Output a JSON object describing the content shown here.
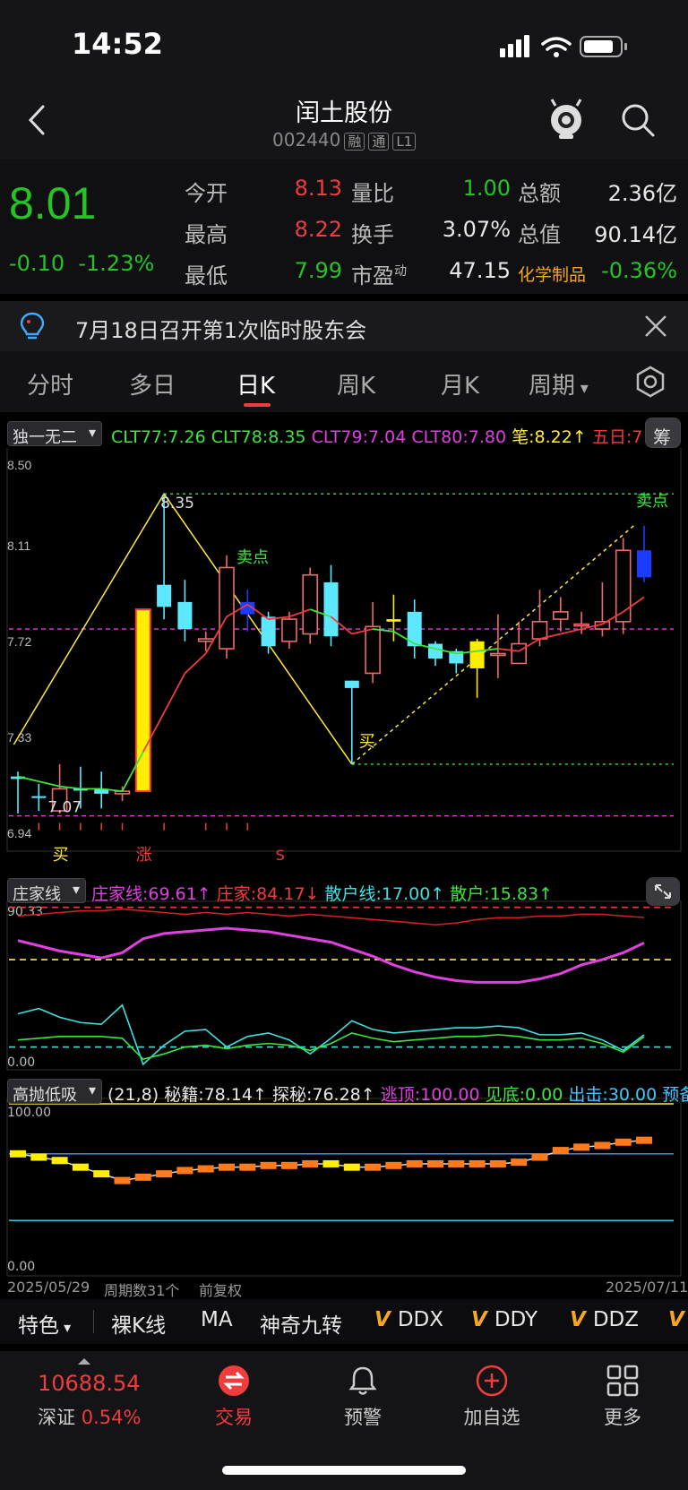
{
  "status": {
    "time": "14:52"
  },
  "header": {
    "title": "闰土股份",
    "code": "002440",
    "tags": [
      "融",
      "通",
      "L1"
    ]
  },
  "quote": {
    "price": "8.01",
    "change": "-0.10",
    "change_pct": "-1.23%",
    "rows": [
      {
        "l1": "今开",
        "v1": "8.13",
        "l2": "量比",
        "v2": "1.00",
        "l3": "总额",
        "v3": "2.36亿"
      },
      {
        "l1": "最高",
        "v1": "8.22",
        "l2": "换手",
        "v2": "3.07%",
        "l3": "总值",
        "v3": "90.14亿"
      },
      {
        "l1": "最低",
        "v1": "7.99",
        "l2": "市盈",
        "l2_sup": "动",
        "v2": "47.15",
        "l3": "化学制品",
        "v3": "-0.36%"
      }
    ],
    "colors": {
      "up": "#f03c3c",
      "down": "#26c326"
    }
  },
  "notice": {
    "text": "7月18日召开第1次临时股东会"
  },
  "tabs": [
    "分时",
    "多日",
    "日K",
    "周K",
    "月K",
    "周期",
    "设置"
  ],
  "active_tab": "日K",
  "main_chart": {
    "indicator_name": "独一无二",
    "legend": [
      {
        "text": "CLT77:7.26",
        "color": "#3ce63c"
      },
      {
        "text": "CLT78:8.35",
        "color": "#3ce63c"
      },
      {
        "text": "CLT79:7.04",
        "color": "#e040e0"
      },
      {
        "text": "CLT80:7.80",
        "color": "#e040e0"
      },
      {
        "text": "笔:8.22↑",
        "color": "#ffeb3b"
      },
      {
        "text": "五日:7",
        "color": "#f03c3c"
      }
    ],
    "chip_button": "筹",
    "y_labels": [
      "8.50",
      "8.11",
      "7.72",
      "7.33",
      "6.94"
    ],
    "annotations": {
      "high": "8.35",
      "low": "7.07",
      "sell1": "卖点",
      "sell2": "卖点",
      "buy1": "买",
      "buy2": "买",
      "zhang": "涨",
      "s": "S"
    }
  },
  "chart_data": {
    "type": "candlestick",
    "ylim": [
      6.94,
      8.5
    ],
    "x_start": "2025/05/29",
    "x_end": "2025/07/11",
    "period_count": "周期数31个",
    "adjust": "前复权",
    "candles": [
      {
        "o": 7.2,
        "c": 7.19,
        "h": 7.22,
        "l": 7.05
      },
      {
        "o": 7.12,
        "c": 7.12,
        "h": 7.17,
        "l": 7.06
      },
      {
        "o": 7.06,
        "c": 7.15,
        "h": 7.25,
        "l": 7.05
      },
      {
        "o": 7.15,
        "c": 7.15,
        "h": 7.24,
        "l": 7.07
      },
      {
        "o": 7.13,
        "c": 7.15,
        "h": 7.22,
        "l": 7.07
      },
      {
        "o": 7.13,
        "c": 7.14,
        "h": 7.16,
        "l": 7.1
      },
      {
        "o": 7.14,
        "c": 7.88,
        "h": 7.88,
        "l": 7.14
      },
      {
        "o": 7.98,
        "c": 7.89,
        "h": 8.35,
        "l": 7.84
      },
      {
        "o": 7.91,
        "c": 7.8,
        "h": 8.0,
        "l": 7.75
      },
      {
        "o": 7.75,
        "c": 7.76,
        "h": 7.79,
        "l": 7.71
      },
      {
        "o": 7.72,
        "c": 8.05,
        "h": 8.1,
        "l": 7.68
      },
      {
        "o": 7.91,
        "c": 7.86,
        "h": 7.96,
        "l": 7.79
      },
      {
        "o": 7.85,
        "c": 7.73,
        "h": 7.87,
        "l": 7.7
      },
      {
        "o": 7.75,
        "c": 7.84,
        "h": 7.87,
        "l": 7.72
      },
      {
        "o": 7.78,
        "c": 8.02,
        "h": 8.05,
        "l": 7.74
      },
      {
        "o": 7.99,
        "c": 7.77,
        "h": 8.06,
        "l": 7.73
      },
      {
        "o": 7.59,
        "c": 7.56,
        "h": 7.59,
        "l": 7.25
      },
      {
        "o": 7.62,
        "c": 7.81,
        "h": 7.91,
        "l": 7.58
      },
      {
        "o": 7.84,
        "c": 7.83,
        "h": 7.94,
        "l": 7.75
      },
      {
        "o": 7.87,
        "c": 7.73,
        "h": 7.92,
        "l": 7.68
      },
      {
        "o": 7.74,
        "c": 7.68,
        "h": 7.75,
        "l": 7.65
      },
      {
        "o": 7.71,
        "c": 7.66,
        "h": 7.72,
        "l": 7.62
      },
      {
        "o": 7.64,
        "c": 7.75,
        "h": 7.76,
        "l": 7.52
      },
      {
        "o": 7.7,
        "c": 7.7,
        "h": 7.86,
        "l": 7.6
      },
      {
        "o": 7.66,
        "c": 7.74,
        "h": 7.83,
        "l": 7.66
      },
      {
        "o": 7.76,
        "c": 7.83,
        "h": 7.96,
        "l": 7.73
      },
      {
        "o": 7.84,
        "c": 7.87,
        "h": 7.93,
        "l": 7.79
      },
      {
        "o": 7.82,
        "c": 7.82,
        "h": 7.87,
        "l": 7.78
      },
      {
        "o": 7.8,
        "c": 7.83,
        "h": 7.99,
        "l": 7.77
      },
      {
        "o": 7.83,
        "c": 8.12,
        "h": 8.17,
        "l": 7.78
      },
      {
        "o": 8.12,
        "c": 8.01,
        "h": 8.22,
        "l": 7.99
      }
    ],
    "ma5": [
      7.2,
      7.18,
      7.16,
      7.15,
      7.15,
      7.14,
      7.3,
      7.46,
      7.62,
      7.7,
      7.85,
      7.9,
      7.84,
      7.85,
      7.88,
      7.85,
      7.78,
      7.8,
      7.79,
      7.74,
      7.72,
      7.7,
      7.71,
      7.72,
      7.71,
      7.76,
      7.78,
      7.8,
      7.82,
      7.87,
      7.93
    ]
  },
  "sub1": {
    "name": "庄家线",
    "legend": [
      {
        "text": "庄家线:69.61↑",
        "color": "#e040e0"
      },
      {
        "text": "庄家:84.17↓",
        "color": "#f03c3c"
      },
      {
        "text": "散户线:17.00↑",
        "color": "#40e0e0"
      },
      {
        "text": "散户:15.83↑",
        "color": "#3ce63c"
      }
    ],
    "y_top": "90.33",
    "y_bottom": "0.00",
    "series": {
      "zhuangjia_line": [
        71,
        68,
        65,
        63,
        61,
        64,
        72,
        75,
        76,
        77,
        78,
        77,
        76,
        74,
        72,
        70,
        66,
        62,
        57,
        53,
        50,
        48,
        47,
        47,
        47,
        49,
        52,
        57,
        60,
        64,
        69.61
      ],
      "zhuangjia": [
        85,
        86,
        87,
        88,
        88,
        89,
        88,
        87,
        86,
        87,
        86,
        87,
        86,
        85,
        86,
        85,
        84,
        83,
        82,
        81,
        80,
        81,
        83,
        84,
        84,
        85,
        85,
        86,
        86,
        85,
        84.17
      ],
      "sanhu_line": [
        29,
        32,
        27,
        24,
        23,
        34,
        0,
        11,
        19,
        20,
        10,
        16,
        18,
        14,
        6,
        15,
        25,
        20,
        18,
        19,
        20,
        21,
        21,
        22,
        21,
        17,
        17,
        18,
        14,
        8,
        17
      ],
      "sanhu": [
        14,
        15,
        16,
        16,
        16,
        15,
        3,
        6,
        10,
        11,
        9,
        11,
        12,
        11,
        8,
        12,
        18,
        15,
        13,
        14,
        15,
        16,
        16,
        17,
        16,
        14,
        14,
        15,
        12,
        7,
        15.83
      ]
    }
  },
  "sub2": {
    "name": "高抛低吸",
    "legend": [
      {
        "text": "(21,8)",
        "color": "#e8e8e8"
      },
      {
        "text": "秘籍:78.14↑",
        "color": "#e8e8e8"
      },
      {
        "text": "探秘:76.28↑",
        "color": "#e8e8e8"
      },
      {
        "text": "逃顶:100.00",
        "color": "#e040e0"
      },
      {
        "text": "见底:0.00",
        "color": "#3ce63c"
      },
      {
        "text": "出击:30.00",
        "color": "#40c8ff"
      },
      {
        "text": "预备:",
        "color": "#40c8ff"
      }
    ],
    "y_top": "100.00",
    "y_bottom": "0.00",
    "series": {
      "miji": [
        70,
        68,
        66,
        62,
        58,
        54,
        56,
        58,
        60,
        61,
        62,
        62,
        63,
        63,
        64,
        64,
        62,
        62,
        63,
        64,
        64,
        64,
        64,
        64,
        65,
        68,
        72,
        74,
        75,
        77,
        78.14
      ],
      "up_flags": [
        false,
        false,
        false,
        false,
        false,
        true,
        true,
        true,
        true,
        true,
        true,
        true,
        true,
        true,
        true,
        false,
        false,
        true,
        true,
        true,
        true,
        true,
        true,
        true,
        true,
        true,
        true,
        true,
        true,
        true,
        true
      ]
    }
  },
  "footer_axis": {
    "start": "2025/05/29",
    "count": "周期数31个",
    "adjust": "前复权",
    "end": "2025/07/11"
  },
  "indicator_bar": [
    "特色",
    "裸K线",
    "MA",
    "神奇九转",
    "DDX",
    "DDY",
    "DDZ",
    ""
  ],
  "bottom_nav": {
    "index_value": "10688.54",
    "index_name": "深证",
    "index_pct": "0.54%",
    "items": [
      "交易",
      "预警",
      "加自选",
      "更多"
    ]
  }
}
